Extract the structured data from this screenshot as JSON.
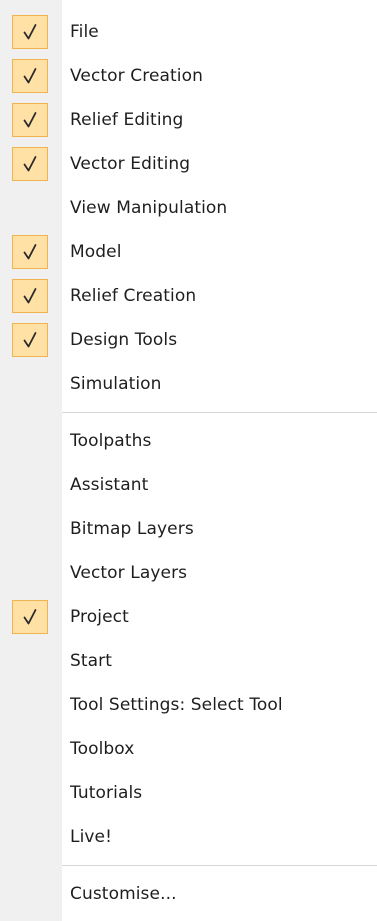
{
  "menu": {
    "items": [
      {
        "label": "File",
        "checked": true
      },
      {
        "label": "Vector Creation",
        "checked": true
      },
      {
        "label": "Relief Editing",
        "checked": true
      },
      {
        "label": "Vector Editing",
        "checked": true
      },
      {
        "label": "View Manipulation",
        "checked": false
      },
      {
        "label": "Model",
        "checked": true
      },
      {
        "label": "Relief Creation",
        "checked": true
      },
      {
        "label": "Design Tools",
        "checked": true
      },
      {
        "label": "Simulation",
        "checked": false
      },
      {
        "separator": true
      },
      {
        "label": "Toolpaths",
        "checked": false
      },
      {
        "label": "Assistant",
        "checked": false
      },
      {
        "label": "Bitmap Layers",
        "checked": false
      },
      {
        "label": "Vector Layers",
        "checked": false
      },
      {
        "label": "Project",
        "checked": true
      },
      {
        "label": "Start",
        "checked": false
      },
      {
        "label": "Tool Settings: Select Tool",
        "checked": false
      },
      {
        "label": "Toolbox",
        "checked": false
      },
      {
        "label": "Tutorials",
        "checked": false
      },
      {
        "label": "Live!",
        "checked": false
      },
      {
        "separator": true
      },
      {
        "label": "Customise...",
        "checked": false
      }
    ],
    "colors": {
      "check_fill": "#ffe1a6",
      "check_border": "#f0b350",
      "gutter": "#f0f0f0",
      "text": "#1e1e1e"
    }
  }
}
